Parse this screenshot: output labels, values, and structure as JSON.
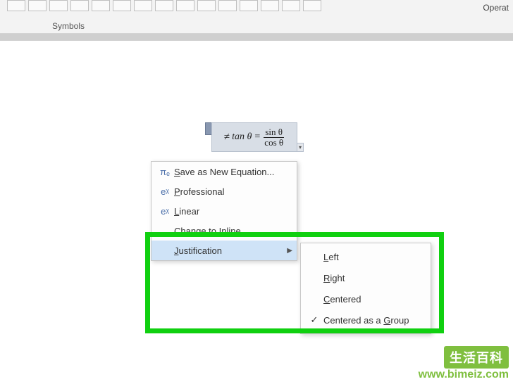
{
  "ribbon": {
    "group_label": "Symbols",
    "right_label": "Operat"
  },
  "equation": {
    "neq": "≠",
    "lhs": "tan θ",
    "eq": "=",
    "num": "sin θ",
    "den": "cos θ"
  },
  "context_menu": {
    "items": [
      {
        "icon": "πₑ",
        "label_pre": "",
        "label_u": "S",
        "label_post": "ave as New Equation..."
      },
      {
        "icon": "eᵡ",
        "label_pre": "",
        "label_u": "P",
        "label_post": "rofessional"
      },
      {
        "icon": "eᵡ",
        "label_pre": "",
        "label_u": "L",
        "label_post": "inear"
      },
      {
        "icon": "",
        "label_pre": "C",
        "label_u": "h",
        "label_post": "ange to Inline"
      },
      {
        "icon": "",
        "label_pre": "",
        "label_u": "J",
        "label_post": "ustification",
        "has_submenu": true,
        "hovered": true
      }
    ]
  },
  "submenu": {
    "items": [
      {
        "checked": false,
        "label_pre": "",
        "label_u": "L",
        "label_post": "eft"
      },
      {
        "checked": false,
        "label_pre": "",
        "label_u": "R",
        "label_post": "ight"
      },
      {
        "checked": false,
        "label_pre": "",
        "label_u": "C",
        "label_post": "entered"
      },
      {
        "checked": true,
        "label_pre": "Centered as a ",
        "label_u": "G",
        "label_post": "roup"
      }
    ]
  },
  "watermark": {
    "title": "生活百科",
    "url": "www.bimeiz.com"
  }
}
